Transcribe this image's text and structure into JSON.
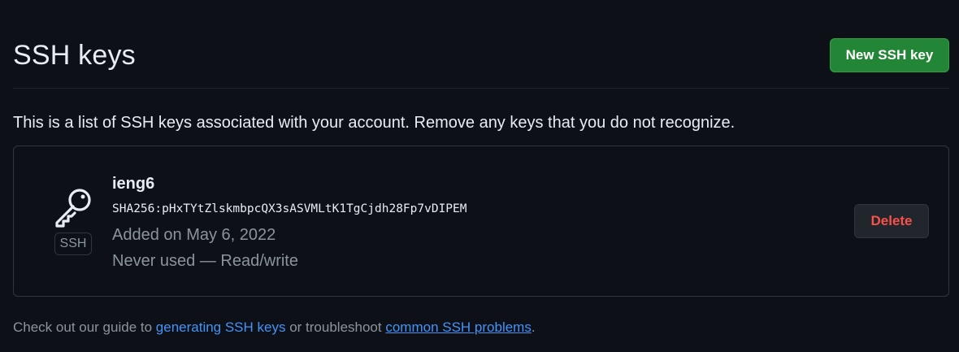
{
  "header": {
    "title": "SSH keys",
    "new_key_button": "New SSH key"
  },
  "description": "This is a list of SSH keys associated with your account. Remove any keys that you do not recognize.",
  "keys": [
    {
      "icon": "key-icon",
      "type_label": "SSH",
      "name": "ieng6",
      "fingerprint": "SHA256:pHxTYtZlskmbpcQX3sASVMLtK1TgCjdh28Fp7vDIPEM",
      "added": "Added on May 6, 2022",
      "usage": "Never used — Read/write",
      "delete_button": "Delete"
    }
  ],
  "footer": {
    "text_before": "Check out our guide to ",
    "link1": "generating SSH keys",
    "text_middle": " or troubleshoot ",
    "link2": "common SSH problems",
    "text_after": "."
  },
  "colors": {
    "background": "#0d1117",
    "primary_button": "#238636",
    "danger_text": "#f85149",
    "link": "#4493f8",
    "muted_text": "#8b949e"
  }
}
